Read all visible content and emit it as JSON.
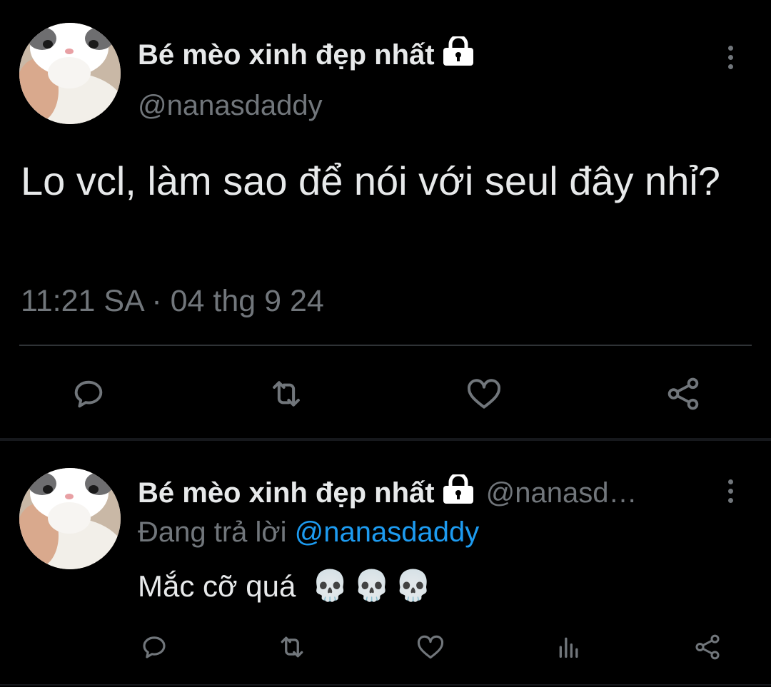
{
  "main_tweet": {
    "display_name": "Bé mèo xinh đẹp nhất",
    "handle": "@nanasdaddy",
    "text": "Lo vcl, làm sao để nói với seul đây nhỉ?",
    "time": "11:21 SA",
    "separator": "·",
    "date": "04 thg 9 24",
    "icons": {
      "lock": "lock-icon",
      "more": "more-vertical-icon",
      "reply": "reply-icon",
      "retweet": "retweet-icon",
      "like": "heart-icon",
      "share": "share-icon"
    }
  },
  "reply_tweet": {
    "display_name": "Bé mèo xinh đẹp nhất",
    "handle": "@nanasd…",
    "replying_prefix": "Đang trả lời",
    "replying_to": "@nanasdaddy",
    "text": "Mắc cỡ quá",
    "emojis": [
      "💀",
      "💀",
      "💀"
    ],
    "icons": {
      "reply": "reply-icon",
      "retweet": "retweet-icon",
      "like": "heart-icon",
      "views": "analytics-icon",
      "share": "share-icon"
    }
  },
  "colors": {
    "background": "#000000",
    "text_primary": "#e7e9ea",
    "text_secondary": "#71767b",
    "link": "#1d9bf0",
    "divider": "#2f3336"
  }
}
